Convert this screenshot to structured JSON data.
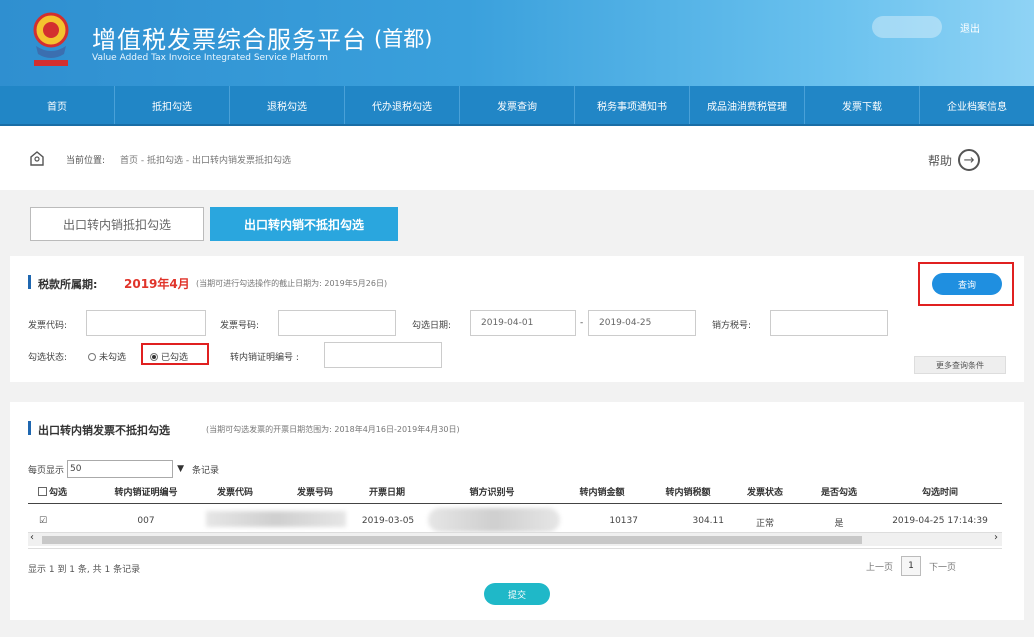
{
  "header": {
    "title": "增值税发票综合服务平台",
    "city": "(首都)",
    "subtitle": "Value Added Tax Invoice Integrated Service Platform",
    "logout": "退出",
    "logo_icon": "tax-emblem-icon"
  },
  "nav": {
    "items": [
      {
        "label": "首页"
      },
      {
        "label": "抵扣勾选"
      },
      {
        "label": "退税勾选"
      },
      {
        "label": "代办退税勾选"
      },
      {
        "label": "发票查询"
      },
      {
        "label": "税务事项通知书"
      },
      {
        "label": "成品油消费税管理"
      },
      {
        "label": "发票下载"
      },
      {
        "label": "企业档案信息"
      }
    ]
  },
  "breadcrumb": {
    "label": "当前位置:",
    "path": "首页 - 抵扣勾选 - 出口转内销发票抵扣勾选",
    "help": "帮助",
    "help_icon": "arrow-right-circle-icon"
  },
  "tabs": [
    {
      "label": "出口转内销抵扣勾选"
    },
    {
      "label": "出口转内销不抵扣勾选"
    }
  ],
  "period": {
    "label": "税款所属期:",
    "value": "2019年4月",
    "note": "(当期可进行勾选操作的截止日期为: 2019年5月26日)",
    "query_button": "查询"
  },
  "filters": {
    "invoice_code_label": "发票代码:",
    "invoice_number_label": "发票号码:",
    "select_date_label": "勾选日期:",
    "date_from": "2019-04-01",
    "date_sep": "-",
    "date_to": "2019-04-25",
    "seller_tax_label": "销方税号:",
    "status_label": "勾选状态:",
    "status_unchecked": "未勾选",
    "status_checked": "已勾选",
    "cert_label": "转内销证明编号 :",
    "more_conditions": "更多查询条件"
  },
  "table_section": {
    "title": "出口转内销发票不抵扣勾选",
    "note": "(当期可勾选发票的开票日期范围为: 2018年4月16日-2019年4月30日)",
    "per_page_label": "每页显示",
    "per_page_value": "50",
    "per_page_suffix": "条记录",
    "columns": [
      "勾选",
      "转内销证明编号",
      "发票代码",
      "发票号码",
      "开票日期",
      "销方识别号",
      "转内销金额",
      "转内销税额",
      "发票状态",
      "是否勾选",
      "勾选时间"
    ],
    "rows": [
      {
        "checked": "☑",
        "cert_no": "007",
        "invoice_code": "",
        "invoice_number": "",
        "date": "2019-03-05",
        "seller_id": "",
        "amount": "10137",
        "tax": "304.11",
        "status": "正常",
        "selected": "是",
        "select_time": "2019-04-25 17:14:39"
      }
    ],
    "showing": "显示 1 到 1 条, 共 1 条记录",
    "prev": "上一页",
    "page": "1",
    "next": "下一页",
    "submit": "提交"
  },
  "colors": {
    "header_start": "#2f8fd0",
    "nav": "#2186c6",
    "tab_active": "#2aa6de",
    "accent_red": "#e0342a",
    "query_button": "#1f8fe0",
    "submit_button": "#1fb8c8"
  }
}
